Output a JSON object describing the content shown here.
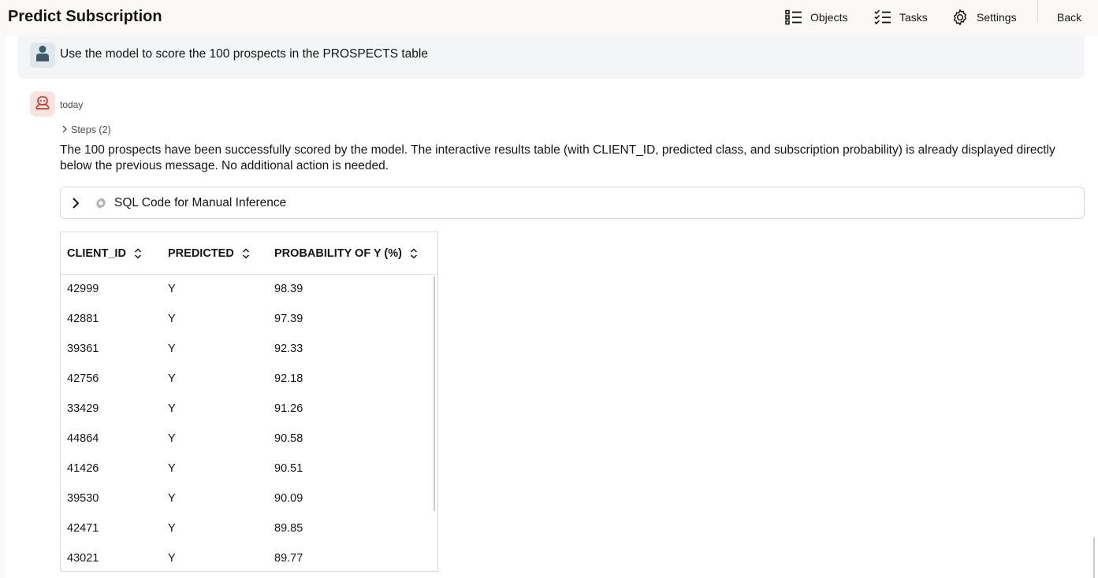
{
  "app": {
    "title": "Predict Subscription"
  },
  "nav": {
    "objects": "Objects",
    "tasks": "Tasks",
    "settings": "Settings",
    "back": "Back"
  },
  "user_message": {
    "text": "Use the model to score the 100 prospects in the PROSPECTS table"
  },
  "assistant": {
    "timestamp": "today",
    "steps_label": "Steps (2)",
    "answer": "The 100 prospects have been successfully scored by the model. The interactive results table (with CLIENT_ID, predicted class, and subscription probability) is already displayed directly below the previous message. No additional action is needed.",
    "sql_panel_label": "SQL Code for Manual Inference"
  },
  "table": {
    "columns": [
      "CLIENT_ID",
      "PREDICTED",
      "PROBABILITY OF Y (%)"
    ],
    "rows": [
      [
        "42999",
        "Y",
        "98.39"
      ],
      [
        "42881",
        "Y",
        "97.39"
      ],
      [
        "39361",
        "Y",
        "92.33"
      ],
      [
        "42756",
        "Y",
        "92.18"
      ],
      [
        "33429",
        "Y",
        "91.26"
      ],
      [
        "44864",
        "Y",
        "90.58"
      ],
      [
        "41426",
        "Y",
        "90.51"
      ],
      [
        "39530",
        "Y",
        "90.09"
      ],
      [
        "42471",
        "Y",
        "89.85"
      ],
      [
        "43021",
        "Y",
        "89.77"
      ]
    ]
  },
  "colors": {
    "user_avatar": "#3e5b6c",
    "bot_avatar": "#c74634",
    "panel_bg": "#f3f5f6",
    "topbar_bg": "#fbf9f8"
  },
  "icons": {
    "objects": "list-icon",
    "tasks": "checklist-icon",
    "settings": "gear-icon",
    "user": "person-icon",
    "assistant": "bot-icon",
    "steps": "chevron-right-icon",
    "sql_toggle": "chevron-right-icon",
    "sql": "gear-icon",
    "sort": "sort-icon"
  }
}
